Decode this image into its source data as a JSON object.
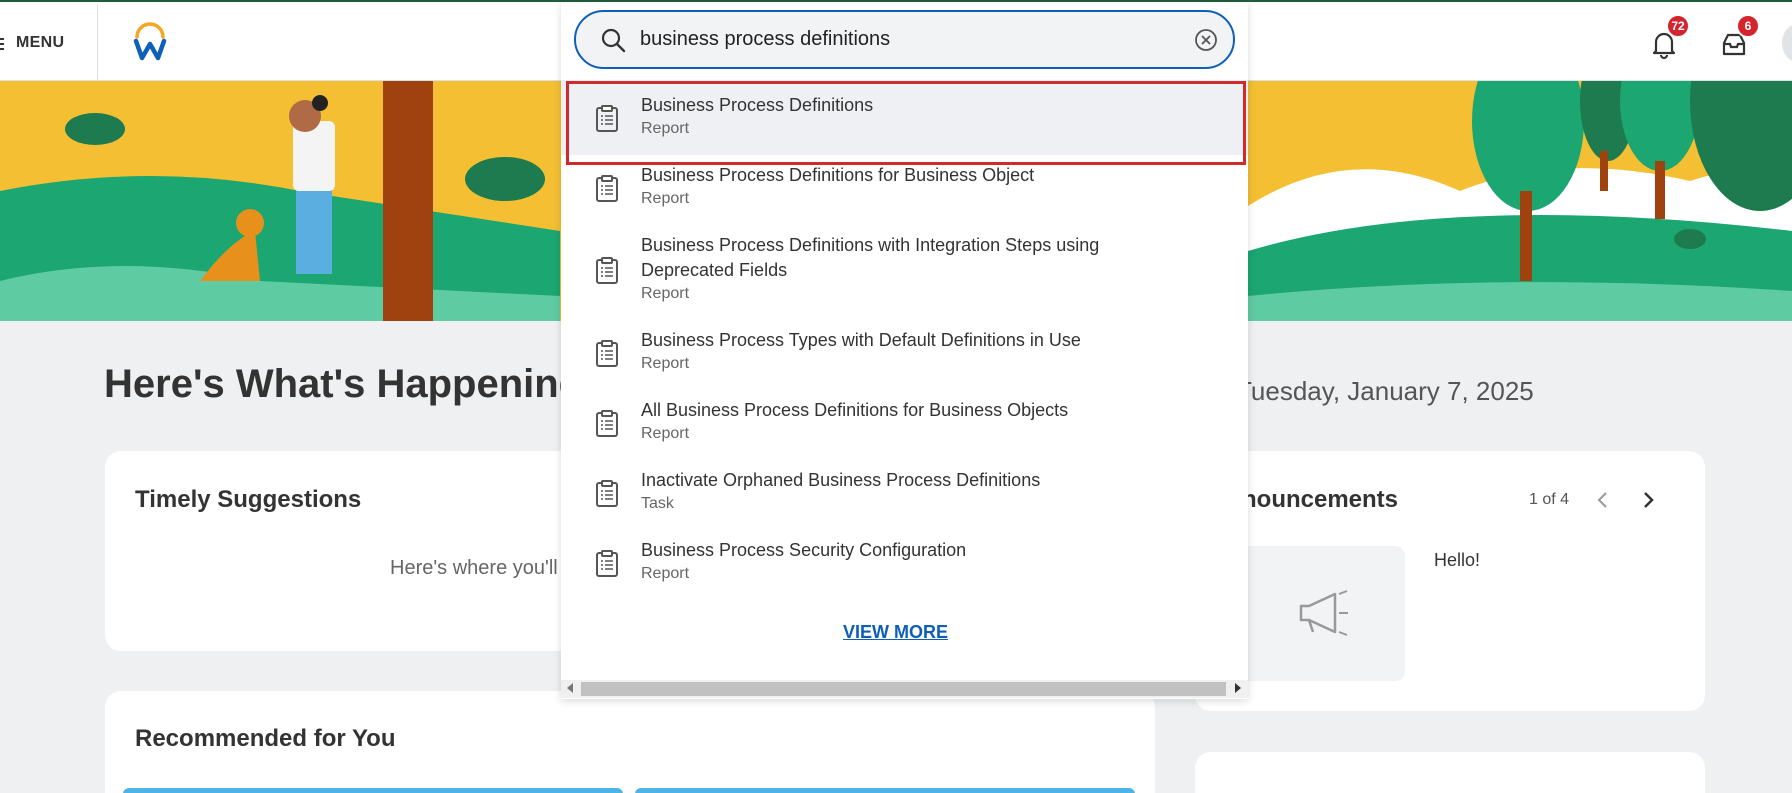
{
  "header": {
    "menu_label": "MENU",
    "notifications_count": "72",
    "inbox_count": "6",
    "accent_color": "#d4242d"
  },
  "main": {
    "heading": "Here's What's Happening",
    "date": "Tuesday, January 7, 2025",
    "timely_suggestions": {
      "title": "Timely Suggestions",
      "body": "Here's where you'll"
    },
    "recommended": {
      "title": "Recommended for You"
    },
    "announcements": {
      "title": "Announcements",
      "pager": "1 of 4",
      "item_text": "Hello!"
    }
  },
  "search": {
    "value": "business process definitions",
    "view_more_label": "VIEW MORE",
    "results": [
      {
        "title": "Business Process Definitions",
        "type": "Report",
        "bold": []
      },
      {
        "title": "Business Process Definitions for Business Object",
        "type": "Report"
      },
      {
        "title": "Business Process Definitions with Integration Steps using Deprecated Fields",
        "type": "Report"
      },
      {
        "title": "Business Process Types with Default Definitions in Use",
        "type": "Report"
      },
      {
        "title": "All Business Process Definitions for Business Objects",
        "type": "Report"
      },
      {
        "title": "Inactivate Orphaned Business Process Definitions",
        "type": "Task"
      },
      {
        "title": "Business Process Security Configuration",
        "type": "Report"
      }
    ]
  },
  "icons": [
    "menu-icon",
    "workday-logo",
    "search-icon",
    "clear-icon",
    "report-icon",
    "bell-icon",
    "inbox-icon",
    "megaphone-icon",
    "chevron-left-icon",
    "chevron-right-icon"
  ]
}
